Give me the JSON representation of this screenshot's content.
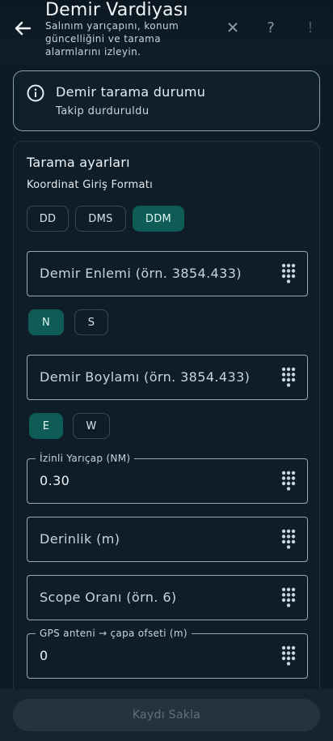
{
  "header": {
    "title": "Demir Vardiyası",
    "subtitle": "Salınım yarıçapını, konum güncelliğini ve tarama alarmlarını izleyin.",
    "close_glyph": "✕",
    "help_glyph": "?",
    "more_glyph": "!"
  },
  "status": {
    "title": "Demir tarama durumu",
    "subtitle": "Takip durduruldu"
  },
  "settings": {
    "title": "Tarama ayarları",
    "format_label": "Koordinat Giriş Formatı",
    "formats": [
      "DD",
      "DMS",
      "DDM"
    ],
    "selected_format": "DDM",
    "latitude": {
      "placeholder": "Demir Enlemi (örn. 3854.433)",
      "value": ""
    },
    "lat_hemis": [
      "N",
      "S"
    ],
    "selected_lat": "N",
    "longitude": {
      "placeholder": "Demir Boylamı (örn. 3854.433)",
      "value": ""
    },
    "lon_hemis": [
      "E",
      "W"
    ],
    "selected_lon": "E",
    "radius": {
      "label": "İzinli Yarıçap (NM)",
      "value": "0.30"
    },
    "depth": {
      "placeholder": "Derinlik (m)",
      "value": ""
    },
    "scope": {
      "placeholder": "Scope Oranı (örn. 6)",
      "value": ""
    },
    "gps_offset": {
      "label": "GPS anteni → çapa ofseti (m)",
      "value": "0"
    }
  },
  "footer": {
    "save_label": "Kaydı Sakla"
  },
  "colors": {
    "accent": "#0f5b55",
    "background": "#0d1b26",
    "disabled_button": "#24343f"
  },
  "icons": [
    "back-arrow-icon",
    "close-icon",
    "help-icon",
    "alert-icon",
    "info-icon",
    "dialpad-icon"
  ]
}
